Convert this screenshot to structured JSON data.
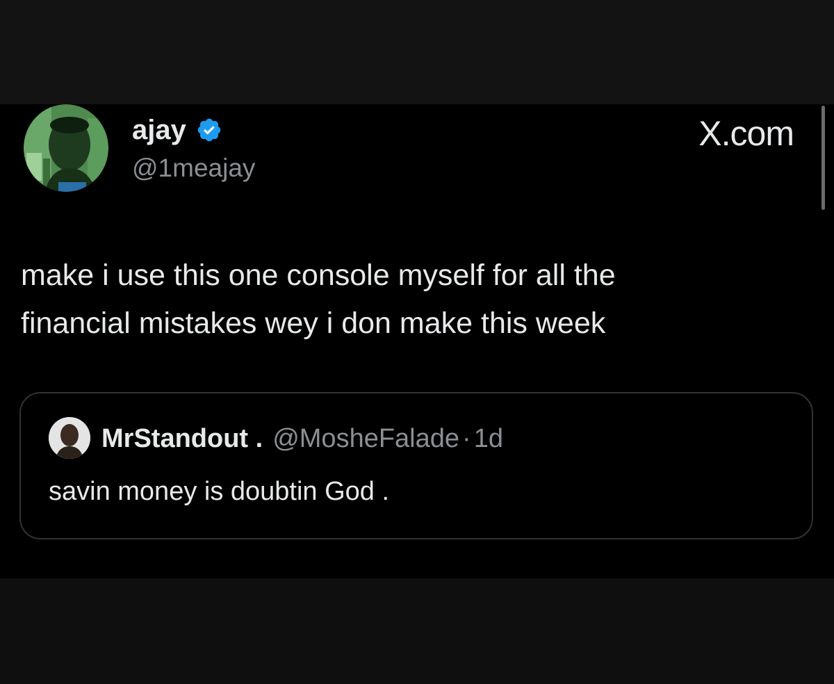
{
  "brand": {
    "label": "X.com"
  },
  "tweet": {
    "author_name": "ajay",
    "author_handle": "@1meajay",
    "verified": true,
    "text_line1": "make i use this one console myself for all the",
    "text_line2": "financial mistakes wey i don make this week"
  },
  "quoted_tweet": {
    "author_name": "MrStandout .",
    "author_handle": "@MosheFalade",
    "separator": "·",
    "time": "1d",
    "text": "savin money is doubtin God ."
  },
  "icons": {
    "verified": "verified-badge-icon",
    "author_avatar": "avatar",
    "quote_avatar": "avatar"
  },
  "colors": {
    "background": "#000000",
    "text_primary": "#e7e9ea",
    "text_secondary": "#8b8f94",
    "verified_blue": "#1d9bf0",
    "quote_border": "#2f3336"
  }
}
